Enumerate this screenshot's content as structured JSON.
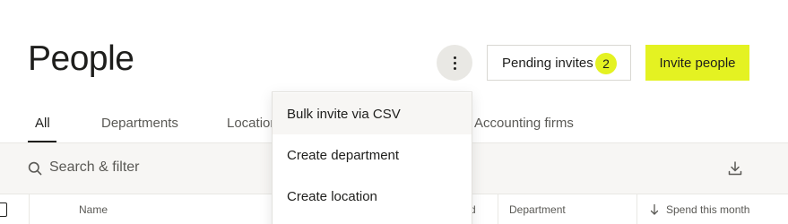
{
  "header": {
    "title": "People",
    "more_icon": "more-vertical-icon",
    "pending_label": "Pending invites",
    "pending_count": "2",
    "invite_label": "Invite people",
    "accent_color": "#e4f222"
  },
  "tabs": [
    {
      "label": "All",
      "active": true
    },
    {
      "label": "Departments",
      "active": false
    },
    {
      "label": "Locations",
      "active": false
    },
    {
      "label": "Accounting firms",
      "active": false
    }
  ],
  "filter": {
    "search_icon": "search-icon",
    "placeholder": "Search & filter",
    "download_icon": "download-icon"
  },
  "table": {
    "columns": [
      {
        "label": "Name"
      },
      {
        "label": "d"
      },
      {
        "label": "Department"
      },
      {
        "label": "Spend this month",
        "sort_icon": "arrow-down-icon"
      }
    ]
  },
  "menu": {
    "items": [
      {
        "label": "Bulk invite via CSV"
      },
      {
        "label": "Create department"
      },
      {
        "label": "Create location"
      }
    ]
  }
}
